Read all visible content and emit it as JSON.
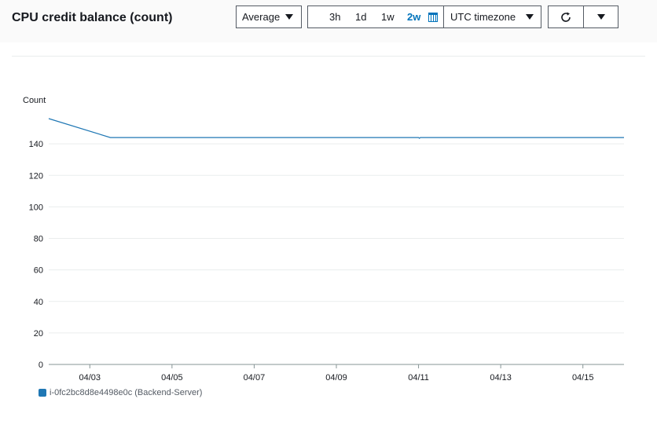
{
  "header": {
    "title": "CPU credit balance (count)",
    "statistic": "Average",
    "ranges": [
      "3h",
      "1d",
      "1w",
      "2w"
    ],
    "active_range": "2w",
    "timezone": "UTC timezone"
  },
  "icons": {
    "statistic_dropdown": "caret-down-icon",
    "calendar": "calendar-icon",
    "timezone_dropdown": "caret-down-icon",
    "refresh": "refresh-icon",
    "more_actions": "caret-down-icon"
  },
  "colors": {
    "series": "#1f77b4",
    "active_range": "#0073bb"
  },
  "chart_data": {
    "type": "line",
    "title": "",
    "ylabel": "Count",
    "xlabel": "",
    "ylim": [
      0,
      160
    ],
    "yticks": [
      0,
      20,
      40,
      60,
      80,
      100,
      120,
      140
    ],
    "xlim": [
      "04/02",
      "04/16"
    ],
    "xticks": [
      "04/03",
      "04/05",
      "04/07",
      "04/09",
      "04/11",
      "04/13",
      "04/15"
    ],
    "grid": true,
    "legend_position": "bottom-left",
    "series": [
      {
        "name": "i-0fc2bc8d8e4498e0c (Backend-Server)",
        "color": "#1f77b4",
        "points": [
          {
            "x": "04/02 00:00",
            "y": 156
          },
          {
            "x": "04/03 12:00",
            "y": 144
          },
          {
            "x": "04/11 00:00",
            "y": 144
          },
          {
            "x": "04/11 00:30",
            "y": 143.5
          },
          {
            "x": "04/11 01:00",
            "y": 144
          },
          {
            "x": "04/16 00:00",
            "y": 144
          }
        ]
      }
    ]
  }
}
